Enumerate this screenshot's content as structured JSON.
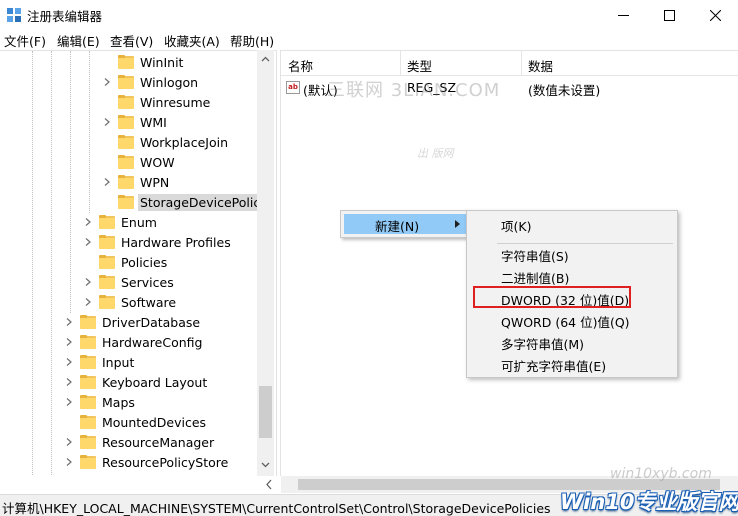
{
  "window": {
    "title": "注册表编辑器",
    "minimize_icon": "minimize-icon",
    "maximize_icon": "maximize-icon",
    "close_icon": "close-icon"
  },
  "menu": [
    "文件(F)",
    "编辑(E)",
    "查看(V)",
    "收藏夹(A)",
    "帮助(H)"
  ],
  "tree": {
    "items": [
      {
        "label": "WinInit",
        "expandable": false
      },
      {
        "label": "Winlogon",
        "expandable": true
      },
      {
        "label": "Winresume",
        "expandable": false
      },
      {
        "label": "WMI",
        "expandable": true
      },
      {
        "label": "WorkplaceJoin",
        "expandable": false
      },
      {
        "label": "WOW",
        "expandable": false
      },
      {
        "label": "WPN",
        "expandable": true
      },
      {
        "label": "StorageDevicePolicie",
        "expandable": false,
        "selected": true
      },
      {
        "label": "Enum",
        "expandable": true
      },
      {
        "label": "Hardware Profiles",
        "expandable": true
      },
      {
        "label": "Policies",
        "expandable": false
      },
      {
        "label": "Services",
        "expandable": true
      },
      {
        "label": "Software",
        "expandable": true
      },
      {
        "label": "DriverDatabase",
        "expandable": true
      },
      {
        "label": "HardwareConfig",
        "expandable": true
      },
      {
        "label": "Input",
        "expandable": true
      },
      {
        "label": "Keyboard Layout",
        "expandable": true
      },
      {
        "label": "Maps",
        "expandable": true
      },
      {
        "label": "MountedDevices",
        "expandable": false
      },
      {
        "label": "ResourceManager",
        "expandable": true
      },
      {
        "label": "ResourcePolicyStore",
        "expandable": true
      }
    ]
  },
  "list": {
    "columns": [
      "名称",
      "类型",
      "数据"
    ],
    "rows": [
      {
        "name": "(默认)",
        "type": "REG_SZ",
        "data": "(数值未设置)"
      }
    ]
  },
  "context_menu": {
    "new_label": "新建(N)",
    "submenu": {
      "key": "项(K)",
      "items": [
        "字符串值(S)",
        "二进制值(B)",
        "DWORD (32 位)值(D)",
        "QWORD (64 位)值(Q)",
        "多字符串值(M)",
        "可扩充字符串值(E)"
      ],
      "highlighted": "DWORD (32 位)值(D)"
    }
  },
  "statusbar": {
    "path": "计算机\\HKEY_LOCAL_MACHINE\\SYSTEM\\CurrentControlSet\\Control\\StorageDevicePolicies"
  },
  "watermarks": {
    "center": "三联网 3LIAN.COM",
    "small": "出 版网",
    "corner": "win10xyb.com",
    "logo": "Win10专业版官网"
  },
  "colors": {
    "menu_highlight": "#91c9f7",
    "selection": "#d9d9d9",
    "annotation_red": "#e02020",
    "folder": "#ffd86b"
  }
}
